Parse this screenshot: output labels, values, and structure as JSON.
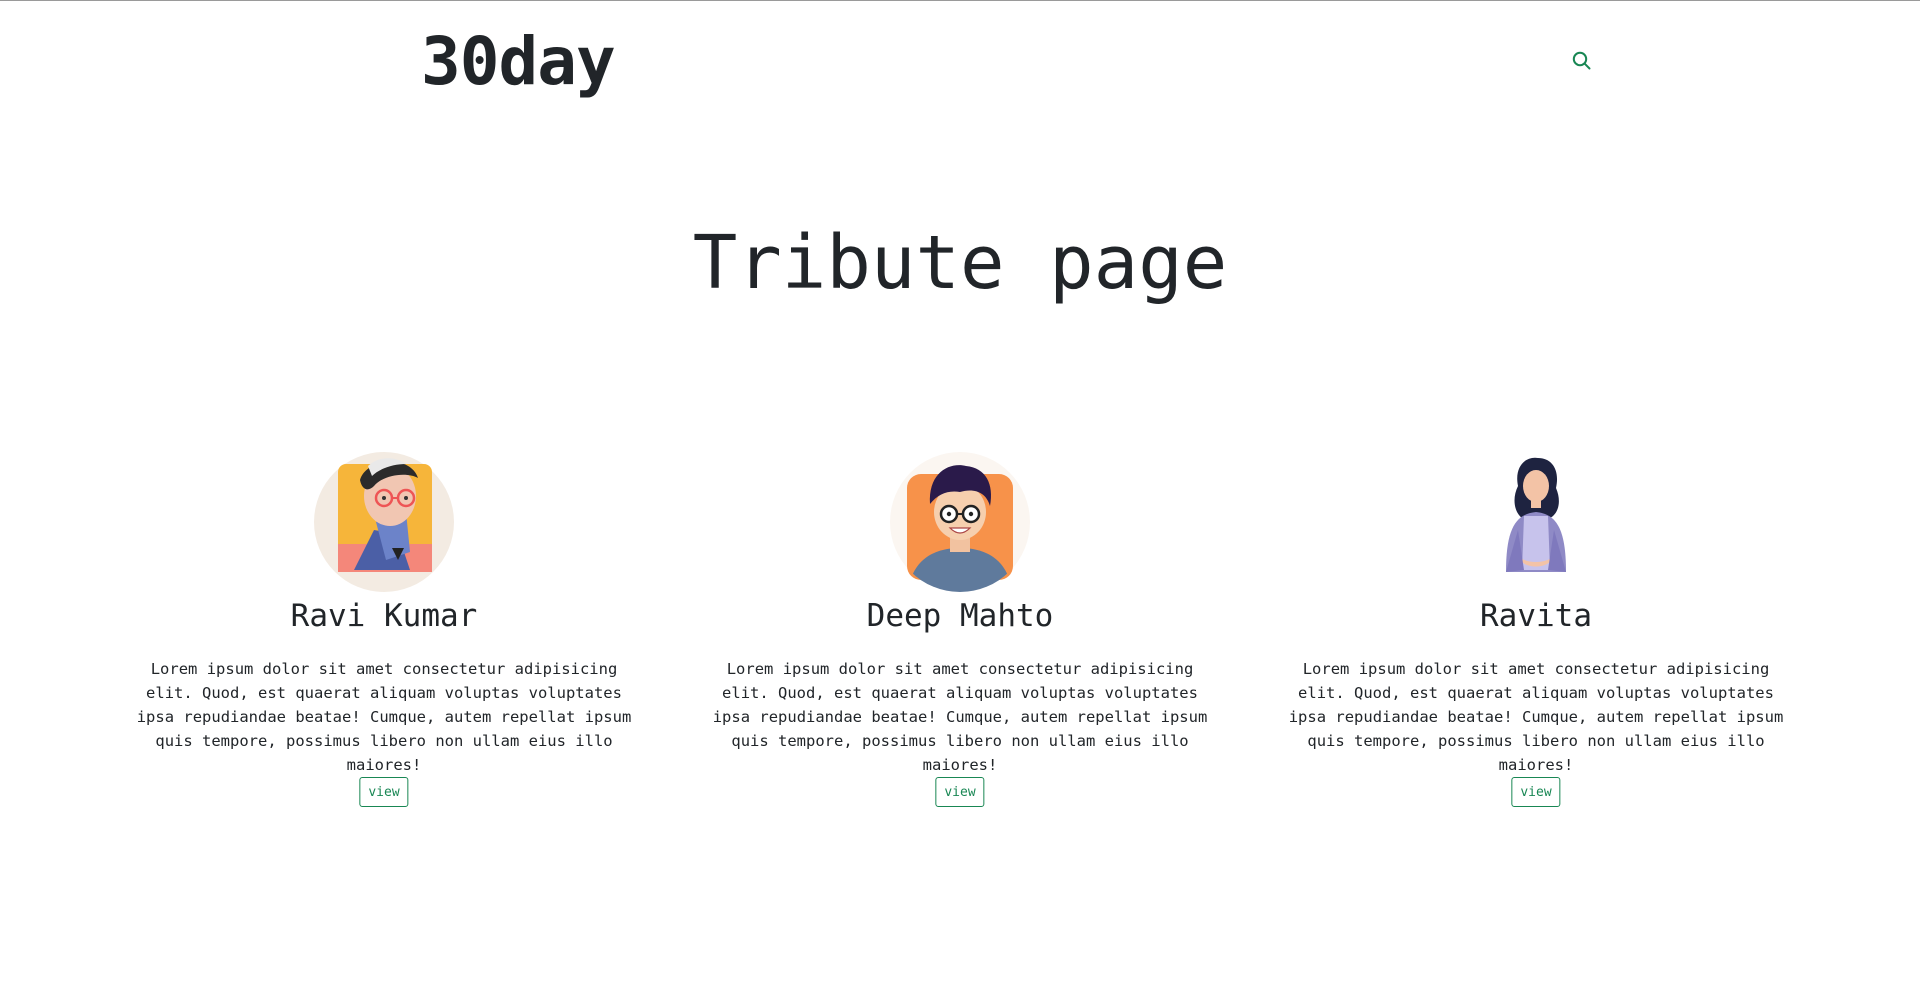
{
  "header": {
    "brand": "30day",
    "search_icon": "search-icon",
    "accent_color": "#198754"
  },
  "hero": {
    "title": "Tribute page"
  },
  "cards": [
    {
      "name": "Ravi Kumar",
      "avatar_icon": "avatar-illustration-collage-man",
      "text": "Lorem ipsum dolor sit amet consectetur adipisicing elit. Quod, est quaerat aliquam voluptas voluptates ipsa repudiandae beatae! Cumque, autem repellat ipsum quis tempore, possimus libero non ullam eius illo maiores!",
      "button_label": "view"
    },
    {
      "name": "Deep Mahto",
      "avatar_icon": "avatar-illustration-boy-glasses",
      "text": "Lorem ipsum dolor sit amet consectetur adipisicing elit. Quod, est quaerat aliquam voluptas voluptates ipsa repudiandae beatae! Cumque, autem repellat ipsum quis tempore, possimus libero non ullam eius illo maiores!",
      "button_label": "view"
    },
    {
      "name": "Ravita",
      "avatar_icon": "avatar-illustration-woman",
      "text": "Lorem ipsum dolor sit amet consectetur adipisicing elit. Quod, est quaerat aliquam voluptas voluptates ipsa repudiandae beatae! Cumque, autem repellat ipsum quis tempore, possimus libero non ullam eius illo maiores!",
      "button_label": "view"
    }
  ]
}
